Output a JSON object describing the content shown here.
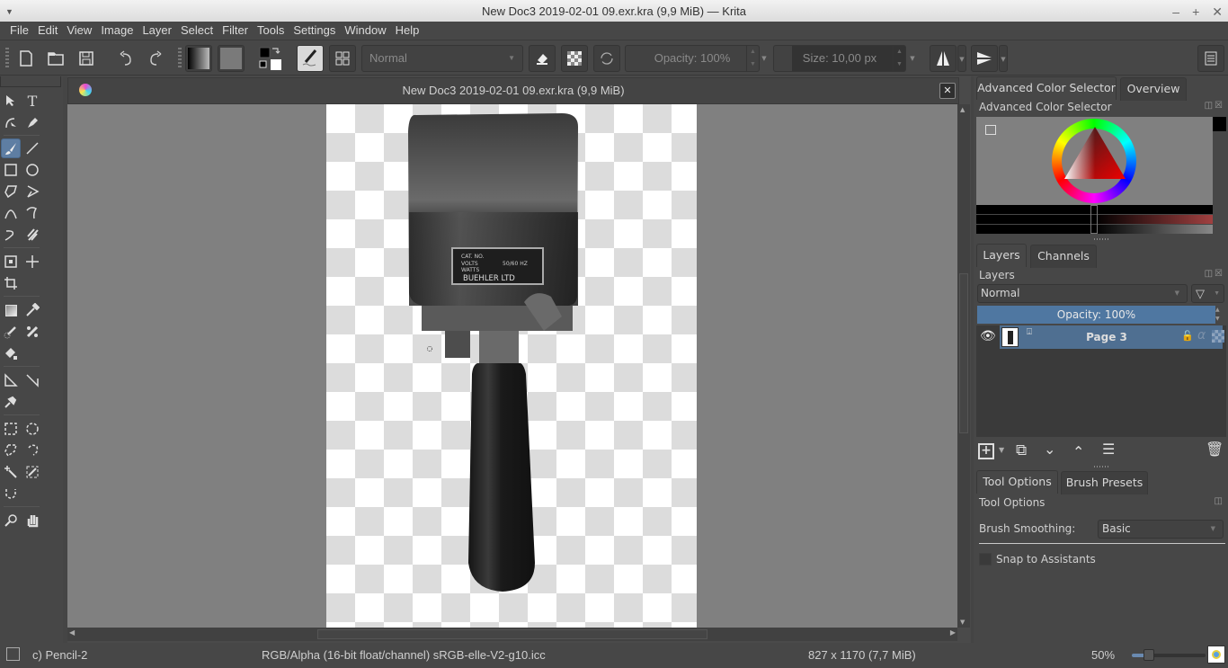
{
  "window": {
    "title": "New Doc3 2019-02-01 09.exr.kra (9,9 MiB)  — Krita",
    "controls": [
      "minimize",
      "maximize",
      "close"
    ]
  },
  "menubar": {
    "items": [
      "File",
      "Edit",
      "View",
      "Image",
      "Layer",
      "Select",
      "Filter",
      "Tools",
      "Settings",
      "Window",
      "Help"
    ]
  },
  "toolbar": {
    "blend_mode": "Normal",
    "opacity_label": "Opacity:  100%",
    "size_label": "Size:  10,00 px",
    "icons": [
      "new-document",
      "open-document",
      "save-document",
      "undo",
      "redo",
      "gradient-preset",
      "pattern-preset",
      "color-swap",
      "brush-preset",
      "workspace-chooser",
      "eraser-mode",
      "preserve-alpha",
      "reload-preset",
      "mirror-horizontal",
      "mirror-vertical",
      "workspace-menu"
    ]
  },
  "document": {
    "subwindow_title": "New Doc3 2019-02-01 09.exr.kra (9,9 MiB)",
    "image_label": {
      "cat_no": "CAT. NO.",
      "volts": "VOLTS",
      "hz": "50/60 HZ",
      "watts": "WATTS",
      "brand": "BUEHLER LTD"
    }
  },
  "toolbox": {
    "tools": [
      "select-shapes",
      "text",
      "edit-shapes",
      "calligraphy",
      "freehand-brush",
      "line",
      "rectangle",
      "ellipse",
      "polygon",
      "polyline",
      "bezier-curve",
      "freehand-path",
      "dynamic-brush",
      "multibrush",
      "transform",
      "move",
      "crop",
      "gradient",
      "color-sampler",
      "colorize-mask",
      "smart-patch",
      "fill",
      "assistant",
      "measure",
      "reference-images",
      "rectangular-selection",
      "elliptical-selection",
      "polygonal-selection",
      "freehand-selection",
      "contiguous-selection",
      "similar-color-selection",
      "bezier-selection",
      "zoom",
      "pan"
    ],
    "active_tool": "freehand-brush"
  },
  "dock": {
    "color_tabs": [
      "Advanced Color Selector",
      "Overview"
    ],
    "color_panel_title": "Advanced Color Selector",
    "layer_tabs": [
      "Layers",
      "Channels"
    ],
    "layers_panel_title": "Layers",
    "layer_blend_mode": "Normal",
    "layer_opacity_label": "Opacity:  100%",
    "layers": [
      {
        "name": "Page 3",
        "visible": true,
        "selected": true
      }
    ],
    "tool_tabs": [
      "Tool Options",
      "Brush Presets"
    ],
    "tool_options_title": "Tool Options",
    "brush_smoothing_label": "Brush Smoothing:",
    "brush_smoothing_value": "Basic",
    "snap_to_assistants_label": "Snap to Assistants",
    "snap_to_assistants_checked": false
  },
  "statusbar": {
    "brush_preset": "c) Pencil-2",
    "color_profile": "RGB/Alpha (16-bit float/channel)  sRGB-elle-V2-g10.icc",
    "image_size": "827 x 1170 (7,7 MiB)",
    "zoom_label": "50%",
    "zoom_percent": 50
  },
  "colors": {
    "accent": "#5e7ea3",
    "panel_bg": "#474747",
    "canvas_bg": "#808080",
    "fg_color": "#000000",
    "bg_color": "#ffffff"
  }
}
